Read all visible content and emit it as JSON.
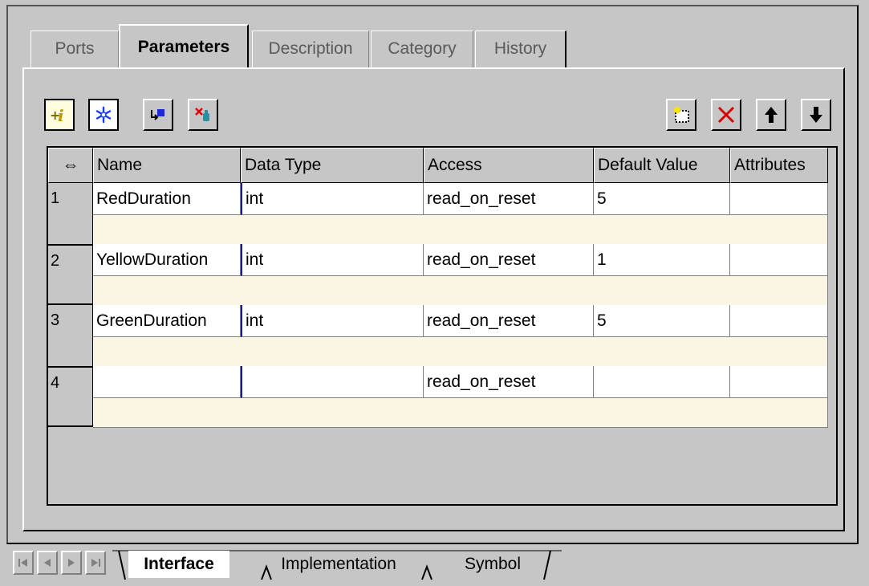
{
  "top_tabs": [
    {
      "label": "Ports"
    },
    {
      "label": "Parameters"
    },
    {
      "label": "Description"
    },
    {
      "label": "Category"
    },
    {
      "label": "History"
    }
  ],
  "toolbar": {
    "left_icons": [
      "info-icon",
      "freeze-icon",
      "import-icon",
      "remove-link-icon"
    ],
    "right_icons": [
      "new-row-icon",
      "delete-icon",
      "move-up-icon",
      "move-down-icon"
    ]
  },
  "table": {
    "corner_symbol": "⇔",
    "columns": [
      "Name",
      "Data Type",
      "Access",
      "Default Value",
      "Attributes"
    ],
    "rows": [
      {
        "num": "1",
        "name": "RedDuration",
        "data_type": "int",
        "access": "read_on_reset",
        "default": "5",
        "attributes": ""
      },
      {
        "num": "2",
        "name": "YellowDuration",
        "data_type": "int",
        "access": "read_on_reset",
        "default": "1",
        "attributes": ""
      },
      {
        "num": "3",
        "name": "GreenDuration",
        "data_type": "int",
        "access": "read_on_reset",
        "default": "5",
        "attributes": ""
      },
      {
        "num": "4",
        "name": "",
        "data_type": "",
        "access": "read_on_reset",
        "default": "",
        "attributes": ""
      }
    ]
  },
  "bottom_tabs": [
    {
      "label": "Interface"
    },
    {
      "label": "Implementation"
    },
    {
      "label": "Symbol"
    }
  ],
  "colors": {
    "background": "#c6c6c6",
    "description_row": "#fbf5e6",
    "cell": "#ffffff"
  }
}
